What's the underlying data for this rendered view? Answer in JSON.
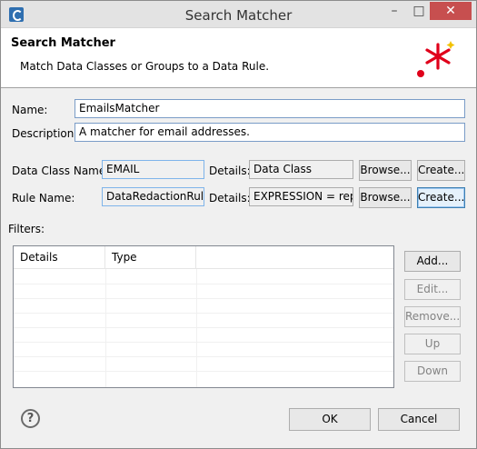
{
  "window": {
    "title": "Search Matcher",
    "minimize": "–",
    "maximize": "□",
    "close": "✕"
  },
  "banner": {
    "title": "Search Matcher",
    "subtitle": "Match Data Classes or Groups to a Data Rule.",
    "icon": "wizard-asterisk-icon"
  },
  "form": {
    "name_label": "Name:",
    "name_value": "EmailsMatcher",
    "description_label": "Description:",
    "description_value": "A matcher for email addresses.",
    "data_class_label": "Data Class Name:",
    "data_class_value": "EMAIL",
    "data_class_details_label": "Details:",
    "data_class_details_value": "Data Class",
    "rule_name_label": "Rule Name:",
    "rule_name_value": "DataRedactionRule",
    "rule_details_label": "Details:",
    "rule_details_value": "EXPRESSION = repla",
    "browse_label": "Browse...",
    "create_label": "Create..."
  },
  "filters": {
    "label": "Filters:",
    "columns": [
      "Details",
      "Type"
    ],
    "buttons": {
      "add": "Add...",
      "edit": "Edit...",
      "remove": "Remove...",
      "up": "Up",
      "down": "Down"
    }
  },
  "footer": {
    "help": "?",
    "ok": "OK",
    "cancel": "Cancel"
  }
}
